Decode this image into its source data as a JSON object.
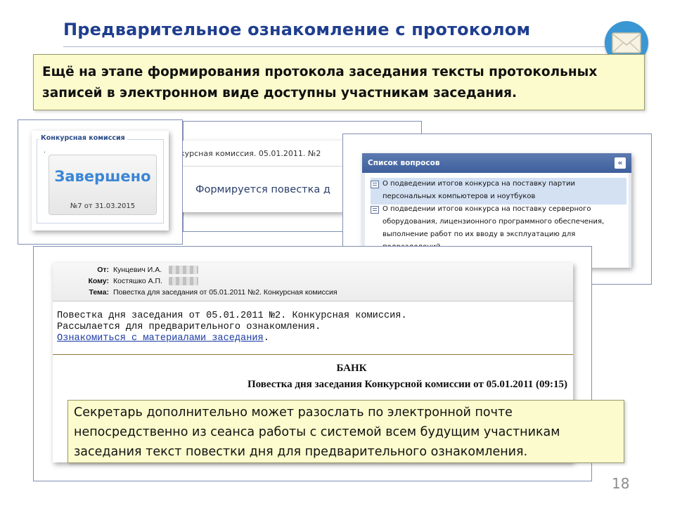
{
  "slide": {
    "title": "Предварительное ознакомление с протоколом",
    "page_number": "18",
    "icons": {
      "mail": "envelope-icon"
    }
  },
  "notes": {
    "top": "Ещё на этапе формирования протокола заседания тексты протокольных записей в электронном виде доступны участникам заседания.",
    "bottom": "Секретарь дополнительно может разослать по электронной почте непосредственно из сеанса работы с системой всем будущим участникам заседания текст повестки дня для предварительного ознакомления."
  },
  "screen_meeting": {
    "breadcrumb": "курсная комиссия. 05.01.2011. №2",
    "agenda_status": "Формируется повестка д"
  },
  "screen_status": {
    "group_label": "Конкурсная комиссия",
    "dot": ".",
    "status": "Завершено",
    "number": "№7 от 31.03.2015"
  },
  "screen_questions": {
    "header": "Список вопросов",
    "collapse_symbol": "«",
    "items": [
      "О подведении итогов конкурса на поставку партии персональных компьютеров и ноутбуков",
      "О подведении итогов конкурса на поставку серверного оборудования, лицензионного программного обеспечения, выполнение работ по их вводу в эксплуатацию для подразделений"
    ]
  },
  "screen_email": {
    "from_label": "От:",
    "from_value": "Кунцевич И.А.",
    "to_label": "Кому:",
    "to_value": "Костяшко А.П.",
    "subject_label": "Тема:",
    "subject_value": "Повестка для заседания от 05.01.2011 №2. Конкурсная комиссия",
    "body_line1": "Повестка дня заседания от 05.01.2011 №2. Конкурсная комиссия.",
    "body_line2": "Рассылается для предварительного ознакомления.",
    "link_text": "Ознакомиться с материалами заседания",
    "link_suffix": ".",
    "bank": "БАНК",
    "agenda_title": "Повестка дня заседания Конкурсной комиссии от 05.01.2011 (09:15)"
  }
}
